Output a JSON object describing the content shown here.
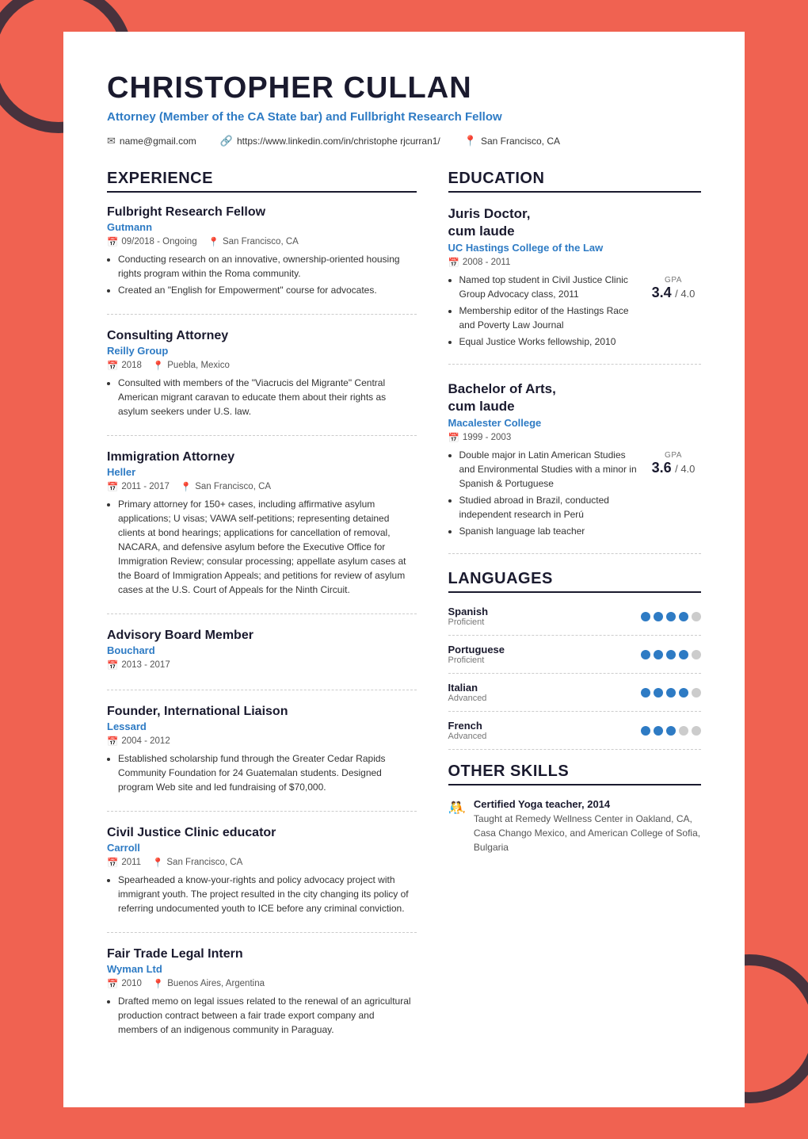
{
  "header": {
    "name": "CHRISTOPHER CULLAN",
    "title": "Attorney (Member of the CA State bar) and Fullbright Research Fellow",
    "email": "name@gmail.com",
    "linkedin": "https://www.linkedin.com/in/christophe rjcurran1/",
    "location": "San Francisco, CA"
  },
  "experience": {
    "section_title": "EXPERIENCE",
    "items": [
      {
        "role": "Fulbright Research Fellow",
        "company": "Gutmann",
        "date": "09/2018 - Ongoing",
        "location": "San Francisco, CA",
        "bullets": [
          "Conducting research on an innovative, ownership-oriented housing rights program within the Roma community.",
          "Created an \"English for Empowerment\" course for advocates."
        ]
      },
      {
        "role": "Consulting Attorney",
        "company": "Reilly Group",
        "date": "2018",
        "location": "Puebla, Mexico",
        "bullets": [
          "Consulted with members of the \"Viacrucis del Migrante\" Central American migrant caravan to educate them about their rights as asylum seekers under U.S. law."
        ]
      },
      {
        "role": "Immigration Attorney",
        "company": "Heller",
        "date": "2011 - 2017",
        "location": "San Francisco, CA",
        "bullets": [
          "Primary attorney for 150+ cases, including affirmative asylum applications; U visas; VAWA self-petitions; representing detained clients at bond hearings; applications for cancellation of removal, NACARA, and defensive asylum before the Executive Office for Immigration Review; consular processing; appellate asylum cases at the Board of Immigration Appeals; and petitions for review of asylum cases at the U.S. Court of Appeals for the Ninth Circuit."
        ]
      },
      {
        "role": "Advisory Board Member",
        "company": "Bouchard",
        "date": "2013 - 2017",
        "location": "",
        "bullets": []
      },
      {
        "role": "Founder, International Liaison",
        "company": "Lessard",
        "date": "2004 - 2012",
        "location": "",
        "bullets": [
          "Established scholarship fund through the Greater Cedar Rapids Community Foundation for 24 Guatemalan students. Designed program Web site and led fundraising of $70,000."
        ]
      },
      {
        "role": "Civil Justice Clinic educator",
        "company": "Carroll",
        "date": "2011",
        "location": "San Francisco, CA",
        "bullets": [
          "Spearheaded a know-your-rights and policy advocacy project with immigrant youth. The project resulted in the city changing its policy of referring undocumented youth to ICE before any criminal conviction."
        ]
      },
      {
        "role": "Fair Trade Legal Intern",
        "company": "Wyman Ltd",
        "date": "2010",
        "location": "Buenos Aires, Argentina",
        "bullets": [
          "Drafted memo on legal issues related to the renewal of an agricultural production contract between a fair trade export company and members of an indigenous community in Paraguay."
        ]
      }
    ]
  },
  "education": {
    "section_title": "EDUCATION",
    "items": [
      {
        "degree": "Juris Doctor, cum laude",
        "school": "UC Hastings College of the Law",
        "date": "2008 - 2011",
        "gpa": "3.4",
        "gpa_max": "4.0",
        "bullets": [
          "Named top student in Civil Justice Clinic Group Advocacy class, 2011",
          "Membership editor of the Hastings Race and Poverty Law Journal",
          "Equal Justice Works fellowship, 2010"
        ]
      },
      {
        "degree": "Bachelor of Arts, cum laude",
        "school": "Macalester College",
        "date": "1999 - 2003",
        "gpa": "3.6",
        "gpa_max": "4.0",
        "bullets": [
          "Double major in Latin American Studies and Environmental Studies with a minor in Spanish & Portuguese",
          "Studied abroad in Brazil, conducted independent research in Perú",
          "Spanish language lab teacher"
        ]
      }
    ]
  },
  "languages": {
    "section_title": "LANGUAGES",
    "items": [
      {
        "name": "Spanish",
        "level": "Proficient",
        "filled": 4,
        "total": 5
      },
      {
        "name": "Portuguese",
        "level": "Proficient",
        "filled": 4,
        "total": 5
      },
      {
        "name": "Italian",
        "level": "Advanced",
        "filled": 4,
        "total": 5
      },
      {
        "name": "French",
        "level": "Advanced",
        "filled": 3,
        "total": 5
      }
    ]
  },
  "other_skills": {
    "section_title": "OTHER SKILLS",
    "items": [
      {
        "name": "Certified Yoga teacher, 2014",
        "description": "Taught at Remedy Wellness Center in Oakland, CA, Casa Chango Mexico, and American College of Sofia, Bulgaria"
      }
    ]
  }
}
